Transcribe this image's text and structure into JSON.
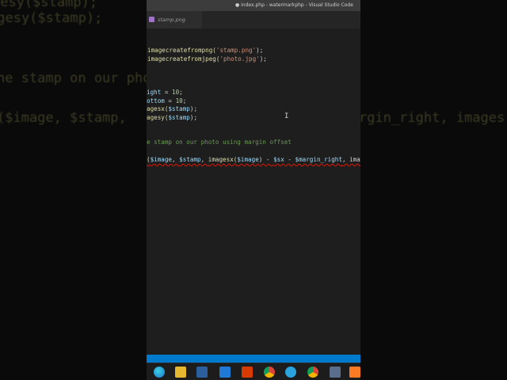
{
  "window": {
    "title": "● index.php - watermarkphp - Visual Studio Code"
  },
  "tab": {
    "label": "stamp.png"
  },
  "code": {
    "l1_fn": "imagecreatefrompng(",
    "l1_str": "'stamp.png'",
    "l1_end": ");",
    "l2_fn": "imagecreatefromjpeg(",
    "l2_str": "'photo.jpg'",
    "l2_end": ");",
    "l3_var": "ight",
    "l3_op": " = ",
    "l3_num": "10",
    "l3_end": ";",
    "l4_var": "ottom",
    "l4_op": " = ",
    "l4_num": "10",
    "l4_end": ";",
    "l5_fn": "agesx(",
    "l5_var": "$stamp",
    "l5_end": ");",
    "l6_fn": "agesy(",
    "l6_var": "$stamp",
    "l6_end": ");",
    "l7_comment": "e stamp on our photo using margin offset",
    "l8_a": "(",
    "l8_v1": "$image",
    "l8_b": ", ",
    "l8_v2": "$stamp",
    "l8_c": ", ",
    "l8_fn": "imagesx(",
    "l8_v3": "$image",
    "l8_d": ") - ",
    "l8_v4": "$sx",
    "l8_e": " - ",
    "l8_v5": "$margin_right",
    "l8_f": ", images"
  },
  "background": {
    "left1": "gesy($stamp);",
    "left2": "agesy($stamp);",
    "left3": "he stamp on our pho",
    "left4": "($image, $stamp, ",
    "right1": "rgin_right, images"
  },
  "taskbar": {
    "icons": [
      "edge-icon",
      "file-explorer-icon",
      "store-icon",
      "mail-icon",
      "office-icon",
      "chrome-icon",
      "telegram-icon",
      "chrome-icon",
      "network-icon",
      "xampp-icon"
    ]
  }
}
